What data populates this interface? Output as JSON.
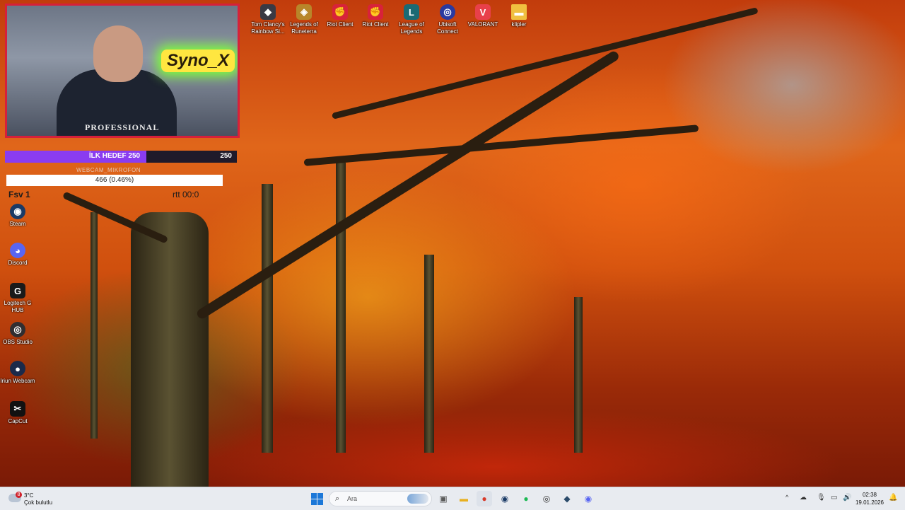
{
  "webcam": {
    "neon_sign": "Syno_X",
    "shirt_text": "PROFESSIONAL"
  },
  "overlay": {
    "goal_label": "İLK HEDEF 250",
    "goal_value": "250",
    "goal_progress": 0.61,
    "source_label": "WEBCAM_MIKROFON",
    "stat_text": "466 (0.46%)",
    "faint_text_left": "Fsv 1",
    "faint_text_right": "rtt 00:0"
  },
  "desktop_top_icons": [
    {
      "icon": "rainbow-six-icon",
      "label": "Tom Clancy's Rainbow Si...",
      "color": "#3a3a44"
    },
    {
      "icon": "legends-of-runeterra-icon",
      "label": "Legends of Runeterra",
      "color": "#b8862a"
    },
    {
      "icon": "riot-client-icon",
      "label": "Riot Client",
      "color": "#d8223a"
    },
    {
      "icon": "riot-client-icon",
      "label": "Riot Client",
      "color": "#d8223a"
    },
    {
      "icon": "league-of-legends-icon",
      "label": "League of Legends",
      "color": "#1c6a74"
    },
    {
      "icon": "ubisoft-connect-icon",
      "label": "Ubisoft Connect",
      "color": "#2a3aa0"
    },
    {
      "icon": "valorant-icon",
      "label": "VALORANT",
      "color": "#e8404a"
    },
    {
      "icon": "folder-icon",
      "label": "klipler",
      "color": "#f0c040"
    }
  ],
  "desktop_left_icons": [
    {
      "icon": "steam-icon",
      "label": "Steam",
      "color": "#1a3a66"
    },
    {
      "icon": "discord-icon",
      "label": "Discord",
      "color": "#5865f2"
    },
    {
      "icon": "logitech-g-hub-icon",
      "label": "Logitech G HUB",
      "color": "#1a1a1a"
    },
    {
      "icon": "obs-studio-icon",
      "label": "OBS Studio",
      "color": "#302e31"
    },
    {
      "icon": "iriun-webcam-icon",
      "label": "Iriun Webcam",
      "color": "#1b2a4a"
    },
    {
      "icon": "capcut-icon",
      "label": "CapCut",
      "color": "#111111"
    }
  ],
  "taskbar": {
    "weather_temp": "3°C",
    "weather_condition": "Çok bulutlu",
    "weather_badge": "8",
    "search_placeholder": "Ara",
    "pinned": [
      {
        "icon": "task-view-icon",
        "glyph": "▣",
        "color": "#5a5a5a"
      },
      {
        "icon": "file-explorer-icon",
        "glyph": "▬",
        "color": "#e8b020"
      },
      {
        "icon": "chrome-icon",
        "glyph": "●",
        "color": "#d83a2a"
      },
      {
        "icon": "steam-icon",
        "glyph": "◉",
        "color": "#1a3a66"
      },
      {
        "icon": "spotify-icon",
        "glyph": "●",
        "color": "#1db954"
      },
      {
        "icon": "obs-studio-icon",
        "glyph": "◎",
        "color": "#303030"
      },
      {
        "icon": "app-icon",
        "glyph": "◆",
        "color": "#2a4a6a"
      },
      {
        "icon": "discord-icon",
        "glyph": "◉",
        "color": "#5865f2"
      }
    ],
    "time": "02:38",
    "date": "19.01.2026"
  }
}
